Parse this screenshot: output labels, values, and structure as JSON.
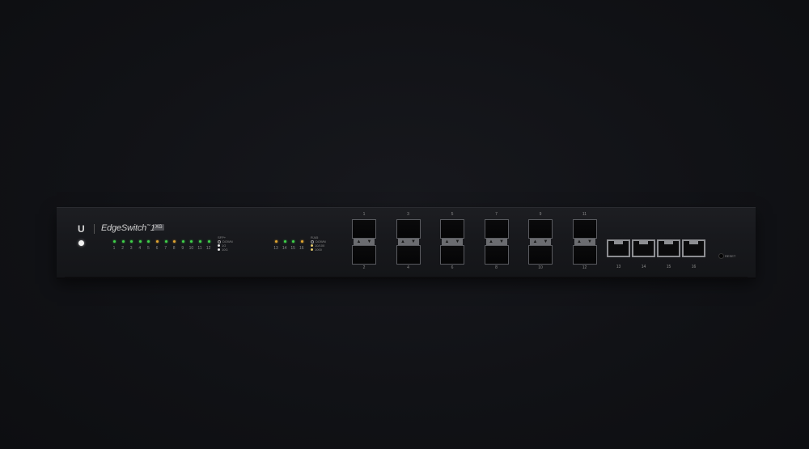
{
  "device": {
    "brand": "EdgeSwitch",
    "model": "16",
    "badge": "XG",
    "logo": "U",
    "colors": {
      "background": "#111216",
      "chassis": "#18191d",
      "link_green": "#3fd14a",
      "link_amber": "#e1a531"
    }
  },
  "sfp_leds": {
    "numbers": [
      "1",
      "2",
      "3",
      "4",
      "5",
      "6",
      "7",
      "8",
      "9",
      "10",
      "11",
      "12"
    ],
    "states": [
      "green",
      "green",
      "green",
      "green",
      "green",
      "amber",
      "green",
      "amber",
      "green",
      "green",
      "green",
      "green"
    ],
    "legend_title": "SFP+",
    "legend": [
      "DOWN",
      "1G",
      "10G"
    ]
  },
  "rj45_leds": {
    "numbers": [
      "13",
      "14",
      "15",
      "16"
    ],
    "states": [
      "amber",
      "green",
      "green",
      "amber"
    ],
    "legend_title": "RJ45",
    "legend": [
      "DOWN",
      "10/100",
      "1000"
    ]
  },
  "sfp_ports": {
    "top": [
      "1",
      "3",
      "5",
      "7",
      "9",
      "11"
    ],
    "bottom": [
      "2",
      "4",
      "6",
      "8",
      "10",
      "12"
    ]
  },
  "rj45_ports": [
    "13",
    "14",
    "15",
    "16"
  ],
  "reset_label": "RESET"
}
